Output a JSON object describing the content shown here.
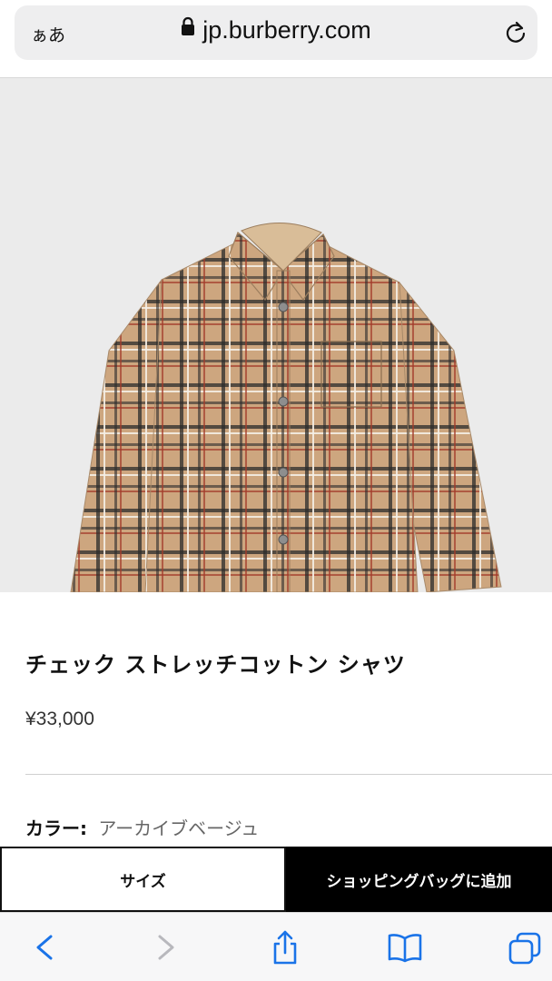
{
  "browser": {
    "text_size_label": "ぁあ",
    "url": "jp.burberry.com",
    "icons": {
      "lock": "lock-icon",
      "reload": "reload-icon"
    }
  },
  "product": {
    "image_alt": "check-shirt-photo",
    "title": "チェック ストレッチコットン シャツ",
    "price": "¥33,000",
    "color_label": "カラー:",
    "color_value": "アーカイブベージュ"
  },
  "actions": {
    "size_label": "サイズ",
    "add_to_bag_label": "ショッピングバッグに追加"
  },
  "toolbar": {
    "icons": [
      "back-icon",
      "forward-icon",
      "share-icon",
      "bookmarks-icon",
      "tabs-icon"
    ]
  },
  "colors": {
    "accent": "#1a73e8",
    "disabled": "#b8b8bd",
    "cta_dark": "#000000",
    "shirt_base": "#cda67f"
  }
}
